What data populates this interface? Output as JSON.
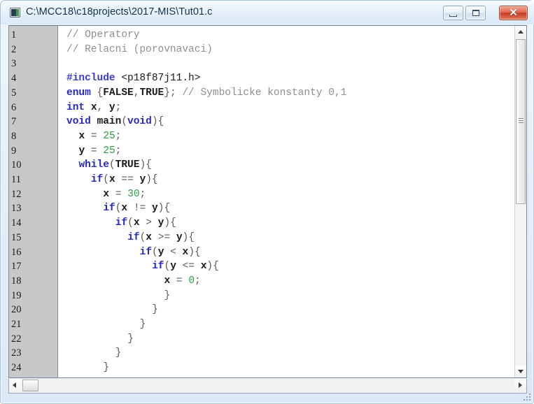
{
  "window": {
    "title": "C:\\MCC18\\c18projects\\2017-MIS\\Tut01.c",
    "icon": "editor-document-icon",
    "controls": {
      "minimize_label": "–",
      "maximize_label": "□",
      "close_label": "✕"
    },
    "colors": {
      "titlebar_top": "#f4f9fd",
      "titlebar_bottom": "#dceaf7",
      "close_button": "#c63c23",
      "gutter_bg": "#c8c8c8",
      "code_bg": "#ffffff",
      "comment": "#8e8e8e",
      "keyword": "#2727c8",
      "preprocessor": "#3a3ad0",
      "number": "#2f9e3f",
      "identifier": "#1b1b1b"
    }
  },
  "editor": {
    "first_visible_line": 1,
    "last_visible_line": 24,
    "line_numbers": [
      "1",
      "2",
      "3",
      "4",
      "5",
      "6",
      "7",
      "8",
      "9",
      "10",
      "11",
      "12",
      "13",
      "14",
      "15",
      "16",
      "17",
      "18",
      "19",
      "20",
      "21",
      "22",
      "23",
      "24"
    ],
    "lines": [
      {
        "n": "1",
        "indent": 0,
        "tokens": [
          {
            "t": "// Operatory",
            "c": "com"
          }
        ]
      },
      {
        "n": "2",
        "indent": 0,
        "tokens": [
          {
            "t": "// Relacni (porovnavaci)",
            "c": "com"
          }
        ]
      },
      {
        "n": "3",
        "indent": 0,
        "tokens": []
      },
      {
        "n": "4",
        "indent": 0,
        "tokens": [
          {
            "t": "#include",
            "c": "pre"
          },
          {
            "t": " ",
            "c": "pun"
          },
          {
            "t": "<p18f87j11.h>",
            "c": "hdr"
          }
        ]
      },
      {
        "n": "5",
        "indent": 0,
        "tokens": [
          {
            "t": "enum",
            "c": "kw"
          },
          {
            "t": " ",
            "c": "pun"
          },
          {
            "t": "{",
            "c": "pun"
          },
          {
            "t": "FALSE",
            "c": "id"
          },
          {
            "t": ",",
            "c": "pun"
          },
          {
            "t": "TRUE",
            "c": "id"
          },
          {
            "t": "};",
            "c": "pun"
          },
          {
            "t": " ",
            "c": "pun"
          },
          {
            "t": "// Symbolicke konstanty 0,1",
            "c": "com"
          }
        ]
      },
      {
        "n": "6",
        "indent": 0,
        "tokens": [
          {
            "t": "int",
            "c": "kw"
          },
          {
            "t": " ",
            "c": "pun"
          },
          {
            "t": "x",
            "c": "id"
          },
          {
            "t": ", ",
            "c": "pun"
          },
          {
            "t": "y",
            "c": "id"
          },
          {
            "t": ";",
            "c": "pun"
          }
        ]
      },
      {
        "n": "7",
        "indent": 0,
        "tokens": [
          {
            "t": "void",
            "c": "kw"
          },
          {
            "t": " ",
            "c": "pun"
          },
          {
            "t": "main",
            "c": "id"
          },
          {
            "t": "(",
            "c": "pun"
          },
          {
            "t": "void",
            "c": "kw"
          },
          {
            "t": "){",
            "c": "pun"
          }
        ]
      },
      {
        "n": "8",
        "indent": 1,
        "tokens": [
          {
            "t": "x",
            "c": "id"
          },
          {
            "t": " = ",
            "c": "pun"
          },
          {
            "t": "25",
            "c": "num"
          },
          {
            "t": ";",
            "c": "pun"
          }
        ]
      },
      {
        "n": "9",
        "indent": 1,
        "tokens": [
          {
            "t": "y",
            "c": "id"
          },
          {
            "t": " = ",
            "c": "pun"
          },
          {
            "t": "25",
            "c": "num"
          },
          {
            "t": ";",
            "c": "pun"
          }
        ]
      },
      {
        "n": "10",
        "indent": 1,
        "tokens": [
          {
            "t": "while",
            "c": "kw"
          },
          {
            "t": "(",
            "c": "pun"
          },
          {
            "t": "TRUE",
            "c": "id"
          },
          {
            "t": "){",
            "c": "pun"
          }
        ]
      },
      {
        "n": "11",
        "indent": 2,
        "tokens": [
          {
            "t": "if",
            "c": "kw"
          },
          {
            "t": "(",
            "c": "pun"
          },
          {
            "t": "x",
            "c": "id"
          },
          {
            "t": " == ",
            "c": "pun"
          },
          {
            "t": "y",
            "c": "id"
          },
          {
            "t": "){",
            "c": "pun"
          }
        ]
      },
      {
        "n": "12",
        "indent": 3,
        "tokens": [
          {
            "t": "x",
            "c": "id"
          },
          {
            "t": " = ",
            "c": "pun"
          },
          {
            "t": "30",
            "c": "num"
          },
          {
            "t": ";",
            "c": "pun"
          }
        ]
      },
      {
        "n": "13",
        "indent": 3,
        "tokens": [
          {
            "t": "if",
            "c": "kw"
          },
          {
            "t": "(",
            "c": "pun"
          },
          {
            "t": "x",
            "c": "id"
          },
          {
            "t": " != ",
            "c": "pun"
          },
          {
            "t": "y",
            "c": "id"
          },
          {
            "t": "){",
            "c": "pun"
          }
        ]
      },
      {
        "n": "14",
        "indent": 4,
        "tokens": [
          {
            "t": "if",
            "c": "kw"
          },
          {
            "t": "(",
            "c": "pun"
          },
          {
            "t": "x",
            "c": "id"
          },
          {
            "t": " > ",
            "c": "pun"
          },
          {
            "t": "y",
            "c": "id"
          },
          {
            "t": "){",
            "c": "pun"
          }
        ]
      },
      {
        "n": "15",
        "indent": 5,
        "tokens": [
          {
            "t": "if",
            "c": "kw"
          },
          {
            "t": "(",
            "c": "pun"
          },
          {
            "t": "x",
            "c": "id"
          },
          {
            "t": " >= ",
            "c": "pun"
          },
          {
            "t": "y",
            "c": "id"
          },
          {
            "t": "){",
            "c": "pun"
          }
        ]
      },
      {
        "n": "16",
        "indent": 6,
        "tokens": [
          {
            "t": "if",
            "c": "kw"
          },
          {
            "t": "(",
            "c": "pun"
          },
          {
            "t": "y",
            "c": "id"
          },
          {
            "t": " < ",
            "c": "pun"
          },
          {
            "t": "x",
            "c": "id"
          },
          {
            "t": "){",
            "c": "pun"
          }
        ]
      },
      {
        "n": "17",
        "indent": 7,
        "tokens": [
          {
            "t": "if",
            "c": "kw"
          },
          {
            "t": "(",
            "c": "pun"
          },
          {
            "t": "y",
            "c": "id"
          },
          {
            "t": " <= ",
            "c": "pun"
          },
          {
            "t": "x",
            "c": "id"
          },
          {
            "t": "){",
            "c": "pun"
          }
        ]
      },
      {
        "n": "18",
        "indent": 8,
        "tokens": [
          {
            "t": "x",
            "c": "id"
          },
          {
            "t": " = ",
            "c": "pun"
          },
          {
            "t": "0",
            "c": "num"
          },
          {
            "t": ";",
            "c": "pun"
          }
        ]
      },
      {
        "n": "19",
        "indent": 8,
        "tokens": [
          {
            "t": "}",
            "c": "pun"
          }
        ]
      },
      {
        "n": "20",
        "indent": 7,
        "tokens": [
          {
            "t": "}",
            "c": "pun"
          }
        ]
      },
      {
        "n": "21",
        "indent": 6,
        "tokens": [
          {
            "t": "}",
            "c": "pun"
          }
        ]
      },
      {
        "n": "22",
        "indent": 5,
        "tokens": [
          {
            "t": "}",
            "c": "pun"
          }
        ]
      },
      {
        "n": "23",
        "indent": 4,
        "tokens": [
          {
            "t": "}",
            "c": "pun"
          }
        ]
      },
      {
        "n": "24",
        "indent": 3,
        "tokens": [
          {
            "t": "}",
            "c": "pun"
          }
        ]
      }
    ]
  },
  "scrollbars": {
    "vertical": {
      "up_arrow": "▲",
      "down_arrow": "▼",
      "thumb_top_pct": 4,
      "thumb_height_pct": 47
    },
    "horizontal": {
      "left_arrow": "◀",
      "right_arrow": "▶",
      "thumb_left_pct": 3,
      "thumb_width_pct": 3
    }
  }
}
